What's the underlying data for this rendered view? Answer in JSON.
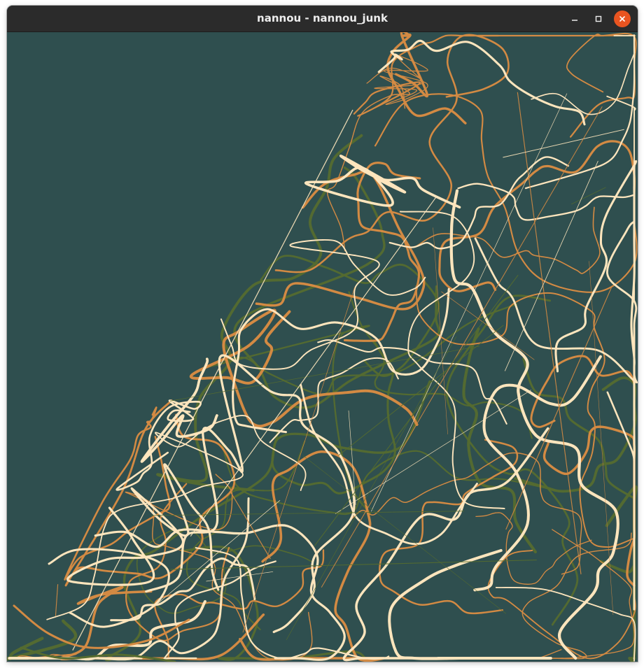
{
  "window": {
    "title": "nannou - nannou_junk",
    "controls": {
      "minimize": "minimize-icon",
      "maximize": "maximize-icon",
      "close": "close-icon"
    }
  },
  "canvas": {
    "background": "#2f4f4f",
    "palette": {
      "cream": "#fde5bd",
      "orange": "#d38a43",
      "olive": "#556b2f"
    }
  }
}
